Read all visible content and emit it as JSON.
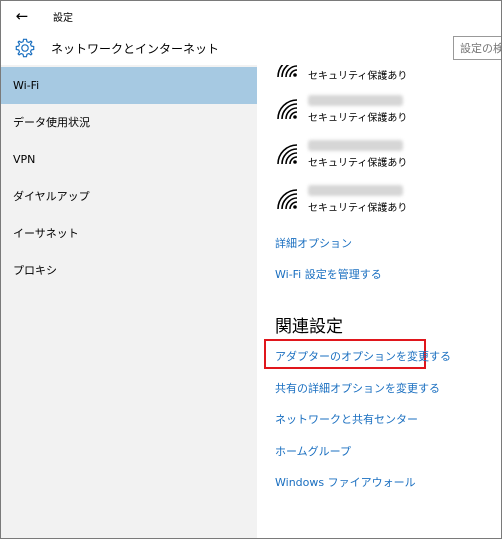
{
  "titlebar": {
    "back_glyph": "←",
    "title": "設定"
  },
  "header": {
    "icon": "gear-icon",
    "title": "ネットワークとインターネット",
    "search_placeholder": "設定の検索"
  },
  "sidebar": {
    "items": [
      {
        "label": "Wi-Fi",
        "active": true
      },
      {
        "label": "データ使用状況"
      },
      {
        "label": "VPN"
      },
      {
        "label": "ダイヤルアップ"
      },
      {
        "label": "イーサネット"
      },
      {
        "label": "プロキシ"
      }
    ]
  },
  "main": {
    "networks": [
      {
        "status": "セキュリティ保護あり"
      },
      {
        "status": "セキュリティ保護あり"
      },
      {
        "status": "セキュリティ保護あり"
      },
      {
        "status": "セキュリティ保護あり"
      }
    ],
    "links": {
      "advanced": "詳細オプション",
      "manage": "Wi-Fi 設定を管理する"
    },
    "related": {
      "title": "関連設定",
      "adapter": "アダプターのオプションを変更する",
      "sharing": "共有の詳細オプションを変更する",
      "network_center": "ネットワークと共有センター",
      "homegroup": "ホームグループ",
      "firewall": "Windows ファイアウォール"
    }
  },
  "colors": {
    "accent": "#1a6fc0",
    "sidebar_active": "#a6c9e2",
    "highlight": "#e0161c"
  }
}
